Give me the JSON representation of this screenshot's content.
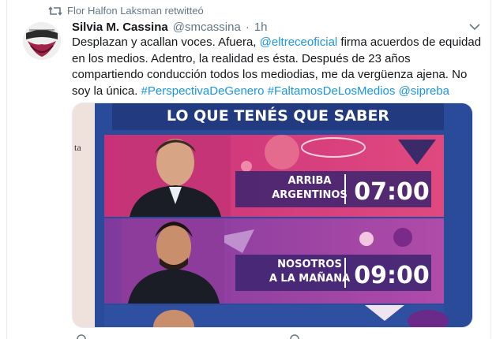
{
  "retweet": {
    "text": "Flor Halfon Laksman retwitteó"
  },
  "author": {
    "name": "Silvia M. Cassina",
    "handle": "@smcassina",
    "separator": "·",
    "time": "1h"
  },
  "tweet": {
    "t1": "Desplazan y acallan voces.  Afuera, ",
    "mention1": "@eltreceoficial",
    "t2": "  firma acuerdos de equidad en los medios. Adentro, la realidad es ésta.  Después de 23 años compartiendo conducción todos los mediodias, me da vergüenza ajena. No soy la única. ",
    "hashtag1": "#PerspectivaDeGenero",
    "hashtag2": "#FaltamosDeLosMedios",
    "mention2": "@sipreba"
  },
  "media": {
    "banner": "LO QUE TENÉS QUE SABER",
    "side_label": "ta",
    "show1": {
      "line1": "ARRIBA",
      "line2": "ARGENTINOS",
      "time": "07:00"
    },
    "show2": {
      "line1": "NOSOTROS",
      "line2": "A LA MAÑANA",
      "time": "09:00"
    }
  },
  "colors": {
    "link": "#1b95e0",
    "banner_bg": "#223a80",
    "row1_bg": "#d8347a",
    "row2_bg": "#9b3da0"
  },
  "icons": [
    "retweet-icon",
    "chevron-down-icon",
    "reply-icon",
    "like-icon"
  ]
}
